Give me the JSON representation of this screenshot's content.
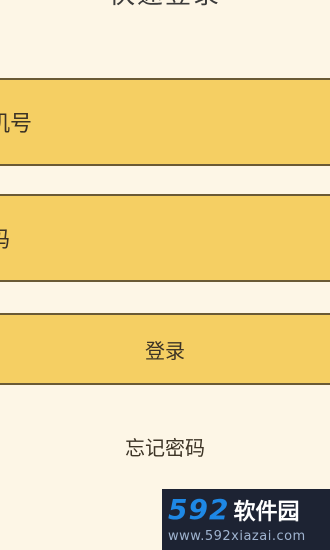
{
  "header": {
    "title": "快速登录"
  },
  "form": {
    "phone_placeholder": "机号",
    "password_placeholder": "码",
    "login_label": "登录",
    "forgot_label": "忘记密码"
  },
  "watermark": {
    "brand_number": "592",
    "brand_text": "软件园",
    "url": "www.592xiazai.com"
  },
  "colors": {
    "background": "#fdf6e6",
    "field_fill": "#f5cf63",
    "field_border": "#6a5a35",
    "text": "#3d3426"
  }
}
